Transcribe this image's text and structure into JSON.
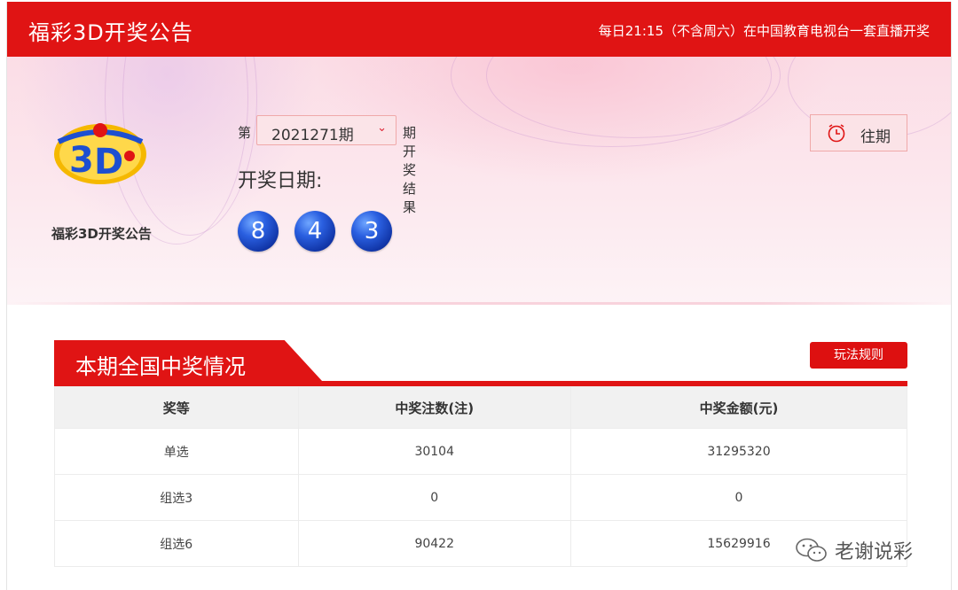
{
  "header": {
    "title": "福彩3D开奖公告",
    "schedule": "每日21:15（不含周六）在中国教育电视台一套直播开奖"
  },
  "logo": {
    "caption": "福彩3D开奖公告",
    "brand_colors": [
      "#e01414",
      "#f5b800",
      "#1d4fd0"
    ]
  },
  "issue": {
    "prefix": "第",
    "selected": "2021271期",
    "suffix": "期开奖结果",
    "dropdown_icon": "chevron-down-icon"
  },
  "draw": {
    "date_label": "开奖日期:",
    "numbers": [
      "8",
      "4",
      "3"
    ]
  },
  "history_button": {
    "label": "往期",
    "icon": "clock-icon"
  },
  "prize_section": {
    "title": "本期全国中奖情况",
    "rules_label": "玩法规则",
    "columns": [
      "奖等",
      "中奖注数(注)",
      "中奖金额(元)"
    ],
    "rows": [
      [
        "单选",
        "30104",
        "31295320"
      ],
      [
        "组选3",
        "0",
        "0"
      ],
      [
        "组选6",
        "90422",
        "15629916"
      ]
    ]
  },
  "watermark": {
    "text": "老谢说彩",
    "icon": "wechat-icon"
  },
  "colors": {
    "accent_red": "#e01414",
    "ball_blue": "#1d4fd0"
  }
}
